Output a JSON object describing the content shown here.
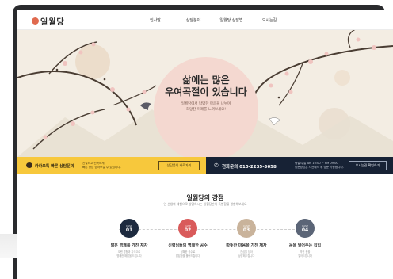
{
  "brand": {
    "logo_text": "일월당"
  },
  "nav": {
    "items": [
      {
        "label": "인사말"
      },
      {
        "label": "상담분야"
      },
      {
        "label": "일월당 상담법"
      },
      {
        "label": "오시는길"
      }
    ]
  },
  "hero": {
    "title_line1": "삶에는 많은",
    "title_line2": "우여곡절이 있습니다",
    "sub_line1": "일월당에서 답답한 마음을 나누며",
    "sub_line2": "희망찬 미래를 느껴보세요!"
  },
  "contact_bar": {
    "kakao_label": "카카오톡 빠른 상담문의",
    "kakao_desc_line1": "친절하고 신속하게",
    "kakao_desc_line2": "빠른 상담 받아보실 수 있습니다.",
    "kakao_button": "상담문의 바로가기",
    "phone_label": "전화문의 010-2235-3658",
    "hours_line1": "평일/주말 AM 10:00 ~ PM 09:00",
    "hours_line2": "방문상담은 사전예약 후 방문 가능합니다.",
    "map_button": "오시는길 확인하기"
  },
  "strengths": {
    "title": "일월당의 강점",
    "subtitle": "안 선생의 체험으로 상담하시는 일월당만의 특별함을 경험해보세요",
    "items": [
      {
        "en": "CASE",
        "num": "01",
        "title": "밝은 명쾌를 가진 재자",
        "desc_line1": "오랜 경험과 지식으로",
        "desc_line2": "명쾌한 해답을 드립니다",
        "color": "#1d2a3f"
      },
      {
        "en": "CASE",
        "num": "02",
        "title": "신령님들의 명쾌한 공수",
        "desc_line1": "정확한 공수로",
        "desc_line2": "답답함을 풀어드립니다",
        "color": "#d95a5a"
      },
      {
        "en": "CASE",
        "num": "03",
        "title": "따뜻한 마음을 가진 재자",
        "desc_line1": "진심을 담아",
        "desc_line2": "상담해드립니다",
        "color": "#c9b39b"
      },
      {
        "en": "CASE",
        "num": "04",
        "title": "운을 열어주는 집입",
        "desc_line1": "막힌 운을",
        "desc_line2": "열어드립니다",
        "color": "#5b6577"
      }
    ]
  },
  "colors": {
    "kakao_yellow": "#f7c83c",
    "navy": "#172235",
    "hero_bg": "#f3ede3",
    "accent_pink": "#f4d8d0"
  }
}
